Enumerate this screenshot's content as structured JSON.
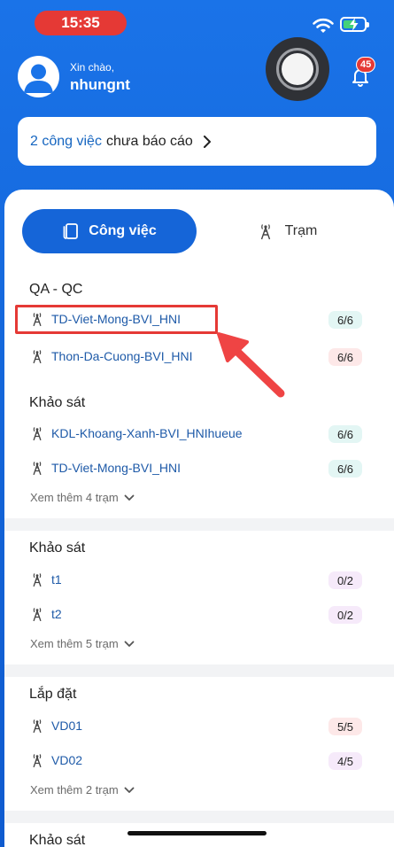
{
  "status_bar": {
    "time": "15:35"
  },
  "header": {
    "greeting": "Xin chào,",
    "username": "nhungnt",
    "notification_count": "45"
  },
  "report_card": {
    "count_text": "2 công việc",
    "rest_text": "chưa báo cáo"
  },
  "tabs": [
    {
      "label": "Công việc",
      "active": true
    },
    {
      "label": "Trạm",
      "active": false
    }
  ],
  "sections": [
    {
      "title": "QA - QC",
      "stations": [
        {
          "name": "TD-Viet-Mong-BVI_HNI",
          "progress": "6/6"
        },
        {
          "name": "Thon-Da-Cuong-BVI_HNI",
          "progress": "6/6"
        }
      ]
    },
    {
      "title": "Khảo sát",
      "stations": [
        {
          "name": "KDL-Khoang-Xanh-BVI_HNIhueue",
          "progress": "6/6"
        },
        {
          "name": "TD-Viet-Mong-BVI_HNI",
          "progress": "6/6"
        }
      ],
      "more": "Xem thêm 4 trạm"
    },
    {
      "title": "Khảo sát",
      "stations": [
        {
          "name": "t1",
          "progress": "0/2"
        },
        {
          "name": "t2",
          "progress": "0/2"
        }
      ],
      "more": "Xem thêm 5 trạm"
    },
    {
      "title": "Lắp đặt",
      "stations": [
        {
          "name": "VD01",
          "progress": "5/5"
        },
        {
          "name": "VD02",
          "progress": "4/5"
        }
      ],
      "more": "Xem thêm 2 trạm"
    },
    {
      "title": "Khảo sát"
    }
  ],
  "colors": {
    "brand_blue": "#1565d8",
    "status_red": "#e53935",
    "pill_teal": "#e3f6f4",
    "pill_pink": "#fde8e8",
    "pill_lavender": "#f6eafa"
  },
  "icons": {
    "tower": "tower-icon",
    "task": "task-icon",
    "bell": "bell-icon",
    "chevron": "chevron-right-icon",
    "expand": "chevron-down-icon"
  }
}
